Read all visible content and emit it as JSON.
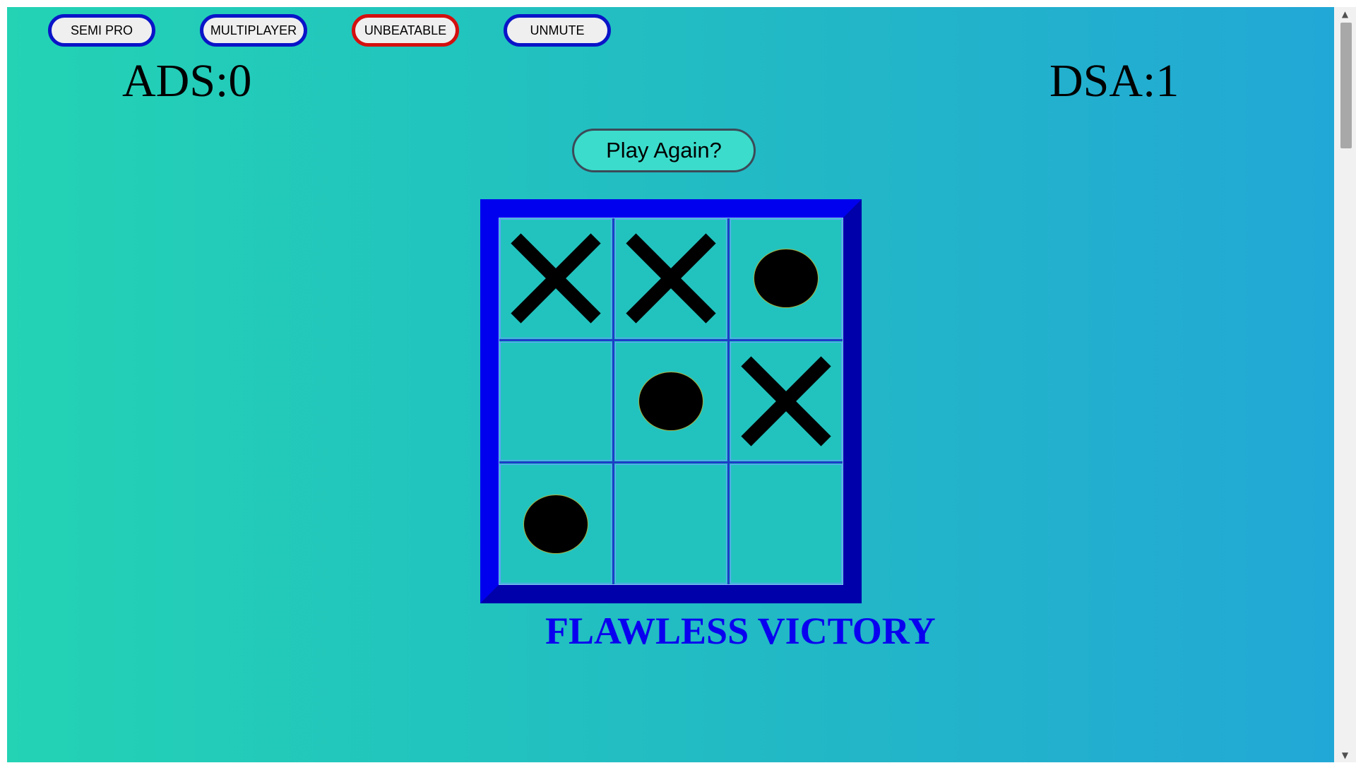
{
  "modes": [
    {
      "label": "SEMI PRO",
      "active": false
    },
    {
      "label": "MULTIPLAYER",
      "active": false
    },
    {
      "label": "UNBEATABLE",
      "active": true
    },
    {
      "label": "UNMUTE",
      "active": false
    }
  ],
  "scores": {
    "left": "ADS:0",
    "right": "DSA:1"
  },
  "play_again_label": "Play Again?",
  "board": [
    [
      "X",
      "X",
      "O"
    ],
    [
      "",
      "O",
      "X"
    ],
    [
      "O",
      "",
      ""
    ]
  ],
  "result_text": "FLAWLESS VICTORY",
  "colors": {
    "active_mode_border": "#d40f0f",
    "mode_border": "#0a14c8",
    "board_frame": "#0000ee",
    "result_text": "#0a00f0"
  },
  "icons": {
    "scroll_up": "scroll-up-arrow-icon",
    "scroll_down": "scroll-down-arrow-icon"
  }
}
